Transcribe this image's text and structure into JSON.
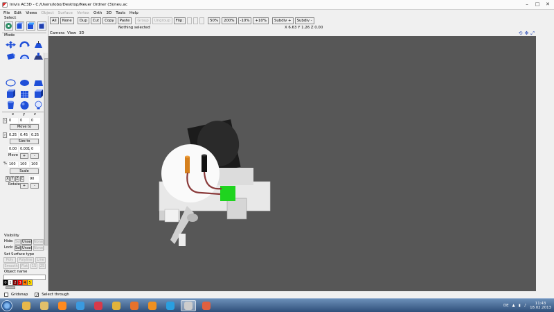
{
  "window": {
    "title": "Inivis AC3D - C:/Users/lobo/Desktop/Neuer Ordner (3)/neu.ac",
    "controls": [
      "–",
      "□",
      "✕"
    ]
  },
  "menu": [
    {
      "label": "File",
      "disabled": false
    },
    {
      "label": "Edit",
      "disabled": false
    },
    {
      "label": "Views",
      "disabled": false
    },
    {
      "label": "Object",
      "disabled": true
    },
    {
      "label": "Surface",
      "disabled": true
    },
    {
      "label": "Vertex",
      "disabled": true
    },
    {
      "label": "Orth",
      "disabled": false
    },
    {
      "label": "3D",
      "disabled": false
    },
    {
      "label": "Tools",
      "disabled": false
    },
    {
      "label": "Help",
      "disabled": false
    }
  ],
  "left_panel": {
    "select_label": "Select",
    "mode_label": "Mode",
    "xyz": [
      "x",
      "y",
      "z"
    ],
    "position": [
      "0",
      "0",
      "0"
    ],
    "move_to": "Move to",
    "size_values": [
      "0.25",
      "0.45",
      "0.25"
    ],
    "size_to": "Size to",
    "move_values": [
      "0.00",
      "0.001",
      "0"
    ],
    "move_label": "Move",
    "plus": "+",
    "minus": "-",
    "percent": "%",
    "scale_values": [
      "100",
      "100",
      "100"
    ],
    "scale_label": "Scale",
    "axes": [
      "X",
      "Y",
      "Z",
      "C"
    ],
    "rotate_angle": "90",
    "rotate_label": "Rotate",
    "visibility_label": "Visibility",
    "hide_label": "Hide:",
    "lock_label": "Lock:",
    "sel": "Sel",
    "unsel": "Unsel",
    "none": "None",
    "surface_label": "Set Surface type",
    "surface_row1": [
      "Poly",
      "Polyline",
      "Line"
    ],
    "surface_row2": [
      "Smooth",
      "Flat",
      "1S",
      "2S"
    ],
    "object_name_label": "Object name"
  },
  "palette": [
    {
      "label": "0",
      "color": "#000000",
      "fg": "#ffffff"
    },
    {
      "label": "1",
      "color": "#ffffff",
      "fg": "#000000"
    },
    {
      "label": "2",
      "color": "#7a0000",
      "fg": "#ffffff"
    },
    {
      "label": "3",
      "color": "#e60000",
      "fg": "#ffffff"
    },
    {
      "label": "4",
      "color": "#ff7a00",
      "fg": "#000000"
    },
    {
      "label": "5",
      "color": "#ffd800",
      "fg": "#000000"
    }
  ],
  "toolbar": {
    "all": "All",
    "none": "None",
    "dup": "Dup",
    "cut": "Cut",
    "copy": "Copy",
    "paste": "Paste",
    "group": "Group",
    "ungroup": "Ungroup",
    "flip": "Flip:",
    "z50": "50%",
    "z200": "200%",
    "zm10": "-10%",
    "zp10": "+10%",
    "subdiv_plus": "Subdiv +",
    "subdiv_minus": "Subdiv -",
    "status": "Nothing selected",
    "coords": "X 6.63 Y 1.26 Z 0.00"
  },
  "viewport": {
    "camera": "Camera",
    "view": "View",
    "mode": "3D",
    "background": "#575757"
  },
  "bottom": {
    "gridsnap": "Gridsnap",
    "gridsnap_checked": false,
    "select_through": "Select through",
    "select_through_checked": true
  },
  "taskbar": {
    "apps": [
      "folder",
      "explorer",
      "media-player",
      "internet-explorer",
      "app-red",
      "chrome",
      "firefox",
      "app-orange",
      "skype",
      "ac3d",
      "app-generic"
    ],
    "language": "DE",
    "time": "11:43",
    "date": "18.02.2013"
  }
}
